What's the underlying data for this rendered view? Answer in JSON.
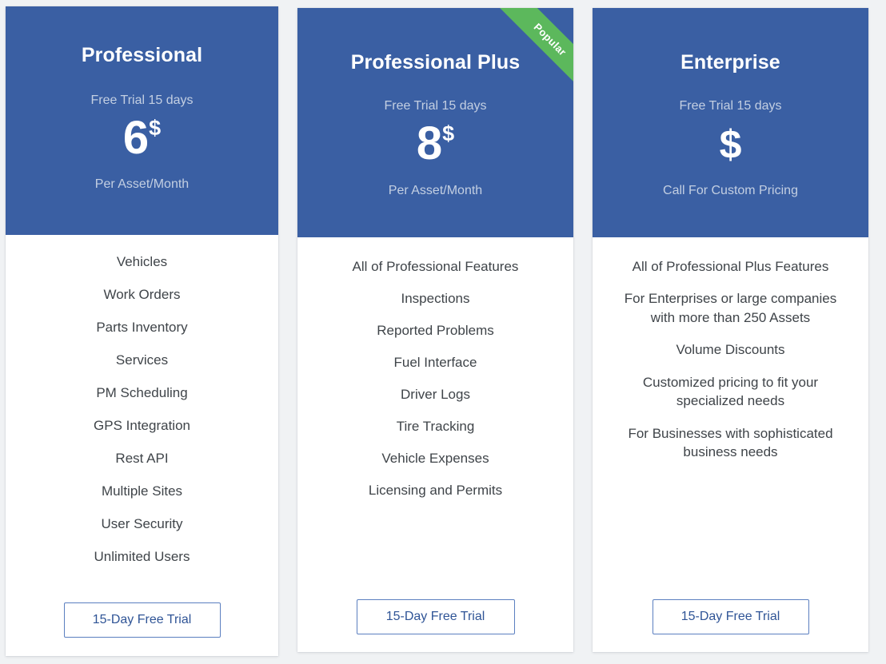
{
  "theme": {
    "page_background": "#f0f2f4",
    "header_blue": "#3a5fa3",
    "ribbon_green": "#5cb85c",
    "muted_text": "#c3cfe2",
    "feature_text": "#3f4449",
    "cta_text": "#2f5496",
    "cta_border": "#5b7fc0"
  },
  "plans": [
    {
      "name": "Professional",
      "trial": "Free Trial 15 days",
      "price_amount": "6",
      "price_currency": "$",
      "unit": "Per Asset/Month",
      "ribbon": null,
      "features": [
        "Vehicles",
        "Work Orders",
        "Parts Inventory",
        "Services",
        "PM Scheduling",
        "GPS Integration",
        "Rest API",
        "Multiple Sites",
        "User Security",
        "Unlimited Users"
      ],
      "cta": "15-Day Free Trial"
    },
    {
      "name": "Professional Plus",
      "trial": "Free Trial 15 days",
      "price_amount": "8",
      "price_currency": "$",
      "unit": "Per Asset/Month",
      "ribbon": "Popular",
      "features": [
        "All of Professional Features",
        "Inspections",
        "Reported Problems",
        "Fuel Interface",
        "Driver Logs",
        "Tire Tracking",
        "Vehicle Expenses",
        "Licensing and Permits"
      ],
      "cta": "15-Day Free Trial"
    },
    {
      "name": "Enterprise",
      "trial": "Free Trial 15 days",
      "price_amount": "",
      "price_currency": "$",
      "unit": "Call For Custom Pricing",
      "ribbon": null,
      "features": [
        "All of Professional Plus Features",
        "For Enterprises or large companies with more than 250 Assets",
        "Volume Discounts",
        "Customized pricing to fit your specialized needs",
        "For Businesses with sophisticated business needs"
      ],
      "cta": "15-Day Free Trial"
    }
  ]
}
